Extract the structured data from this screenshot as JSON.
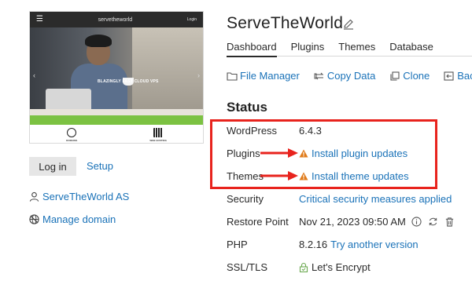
{
  "thumbnail": {
    "brand": "servetheworld",
    "login": "Login",
    "tagline": "BLAZINGLY FAST CLOUD VPS",
    "tiles": [
      "DOMAINS",
      "WEB HOSTING"
    ]
  },
  "left": {
    "login_button": "Log in",
    "setup_link": "Setup",
    "owner": "ServeTheWorld AS",
    "manage_domain": "Manage domain"
  },
  "site": {
    "title": "ServeTheWorld"
  },
  "tabs": [
    {
      "label": "Dashboard",
      "active": true
    },
    {
      "label": "Plugins",
      "active": false
    },
    {
      "label": "Themes",
      "active": false
    },
    {
      "label": "Database",
      "active": false
    }
  ],
  "actions": [
    {
      "label": "File Manager",
      "icon": "folder-icon"
    },
    {
      "label": "Copy Data",
      "icon": "copy-data-icon"
    },
    {
      "label": "Clone",
      "icon": "clone-icon"
    },
    {
      "label": "Back Up",
      "icon": "backup-icon"
    }
  ],
  "status": {
    "heading": "Status",
    "rows": [
      {
        "label": "WordPress",
        "value": "6.4.3"
      },
      {
        "label": "Plugins",
        "value": "Install plugin updates"
      },
      {
        "label": "Themes",
        "value": "Install theme updates"
      },
      {
        "label": "Security",
        "value": "Critical security measures applied"
      },
      {
        "label": "Restore Point",
        "value": "Nov 21, 2023 09:50 AM"
      },
      {
        "label": "PHP",
        "value": "8.2.16",
        "link": "Try another version"
      },
      {
        "label": "SSL/TLS",
        "value": "Let's Encrypt"
      }
    ]
  },
  "colors": {
    "link": "#1a72b8",
    "annotation_red": "#e8231d",
    "warning": "#e07b1a",
    "ssl_green": "#6aa84f"
  }
}
